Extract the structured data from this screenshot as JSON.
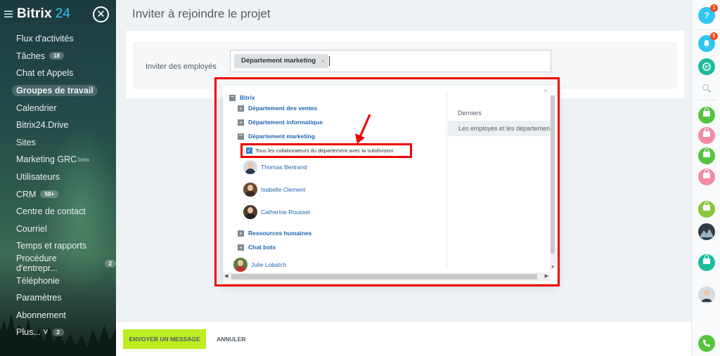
{
  "app": {
    "name": "Bitrix",
    "version": "24"
  },
  "sidebar": {
    "items": [
      {
        "label": "Flux d'activités"
      },
      {
        "label": "Tâches",
        "badge": "18"
      },
      {
        "label": "Chat et Appels"
      },
      {
        "label": "Groupes de travail",
        "active": true
      },
      {
        "label": "Calendrier"
      },
      {
        "label": "Bitrix24.Drive"
      },
      {
        "label": "Sites"
      },
      {
        "label": "Marketing GRC",
        "tag": "beta"
      },
      {
        "label": "Utilisateurs"
      },
      {
        "label": "CRM",
        "badge": "50+"
      },
      {
        "label": "Centre de contact"
      },
      {
        "label": "Courriel"
      },
      {
        "label": "Temps et rapports"
      },
      {
        "label": "Procédure d'entrepr...",
        "badge": "2"
      },
      {
        "label": "Téléphonie"
      },
      {
        "label": "Paramètres"
      },
      {
        "label": "Abonnement"
      },
      {
        "label": "Plus... ˅",
        "badge": "2"
      }
    ]
  },
  "main": {
    "title": "Inviter à rejoindre le projet",
    "invite_label": "Inviter des employés",
    "selected_tag": "Département marketing",
    "tag_remove": "×"
  },
  "popup": {
    "close": "×",
    "root": "Bitrix",
    "departments": {
      "ventes": "Département des ventes",
      "informatique": "Département informatique",
      "marketing": "Département marketing",
      "rh": "Ressources humaines",
      "bots": "Chat bots"
    },
    "select_all_label": "Tous les collaborateurs du département avec la subdivision",
    "employees": [
      "Thomas Bertrand",
      "Isabelle Clement",
      "Catherine Roussel"
    ],
    "other_employee": "Julie Lobatch",
    "tabs": {
      "recent": "Derniers",
      "structure": "Les employés et les départements"
    }
  },
  "footer": {
    "send_label": "ENVOYER UN MESSAGE",
    "cancel_label": "ANNULER"
  },
  "rightbar": {
    "help_label": "?",
    "help_badge": "1",
    "notif_badge": "5"
  },
  "colors": {
    "accent_green": "#bbed21",
    "link_blue": "#2067b0",
    "annotation_red": "#e00000",
    "lock_green": "#55c43b",
    "lock_pink": "#f28ba6",
    "help_blue": "#2fc6f6"
  }
}
